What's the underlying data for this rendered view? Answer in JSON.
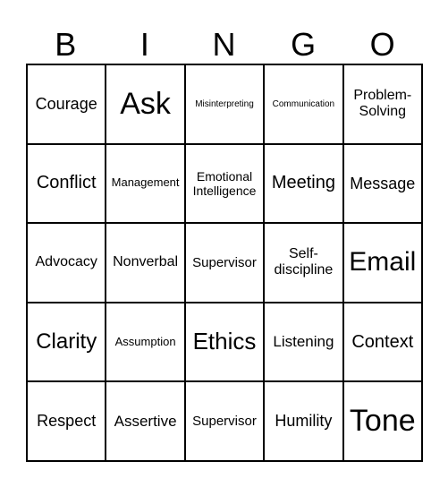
{
  "header": {
    "letters": [
      "B",
      "I",
      "N",
      "G",
      "O"
    ]
  },
  "grid": {
    "rows": [
      [
        "Courage",
        "Ask",
        "Misinterpreting",
        "Communication",
        "Problem-\nSolving"
      ],
      [
        "Conflict",
        "Management",
        "Emotional Intelligence",
        "Meeting",
        "Message"
      ],
      [
        "Advocacy",
        "Nonverbal",
        "Supervisor",
        "Self-\ndiscipline",
        "Email"
      ],
      [
        "Clarity",
        "Assumption",
        "Ethics",
        "Listening",
        "Context"
      ],
      [
        "Respect",
        "Assertive",
        "Supervisor",
        "Humility",
        "Tone"
      ]
    ]
  }
}
